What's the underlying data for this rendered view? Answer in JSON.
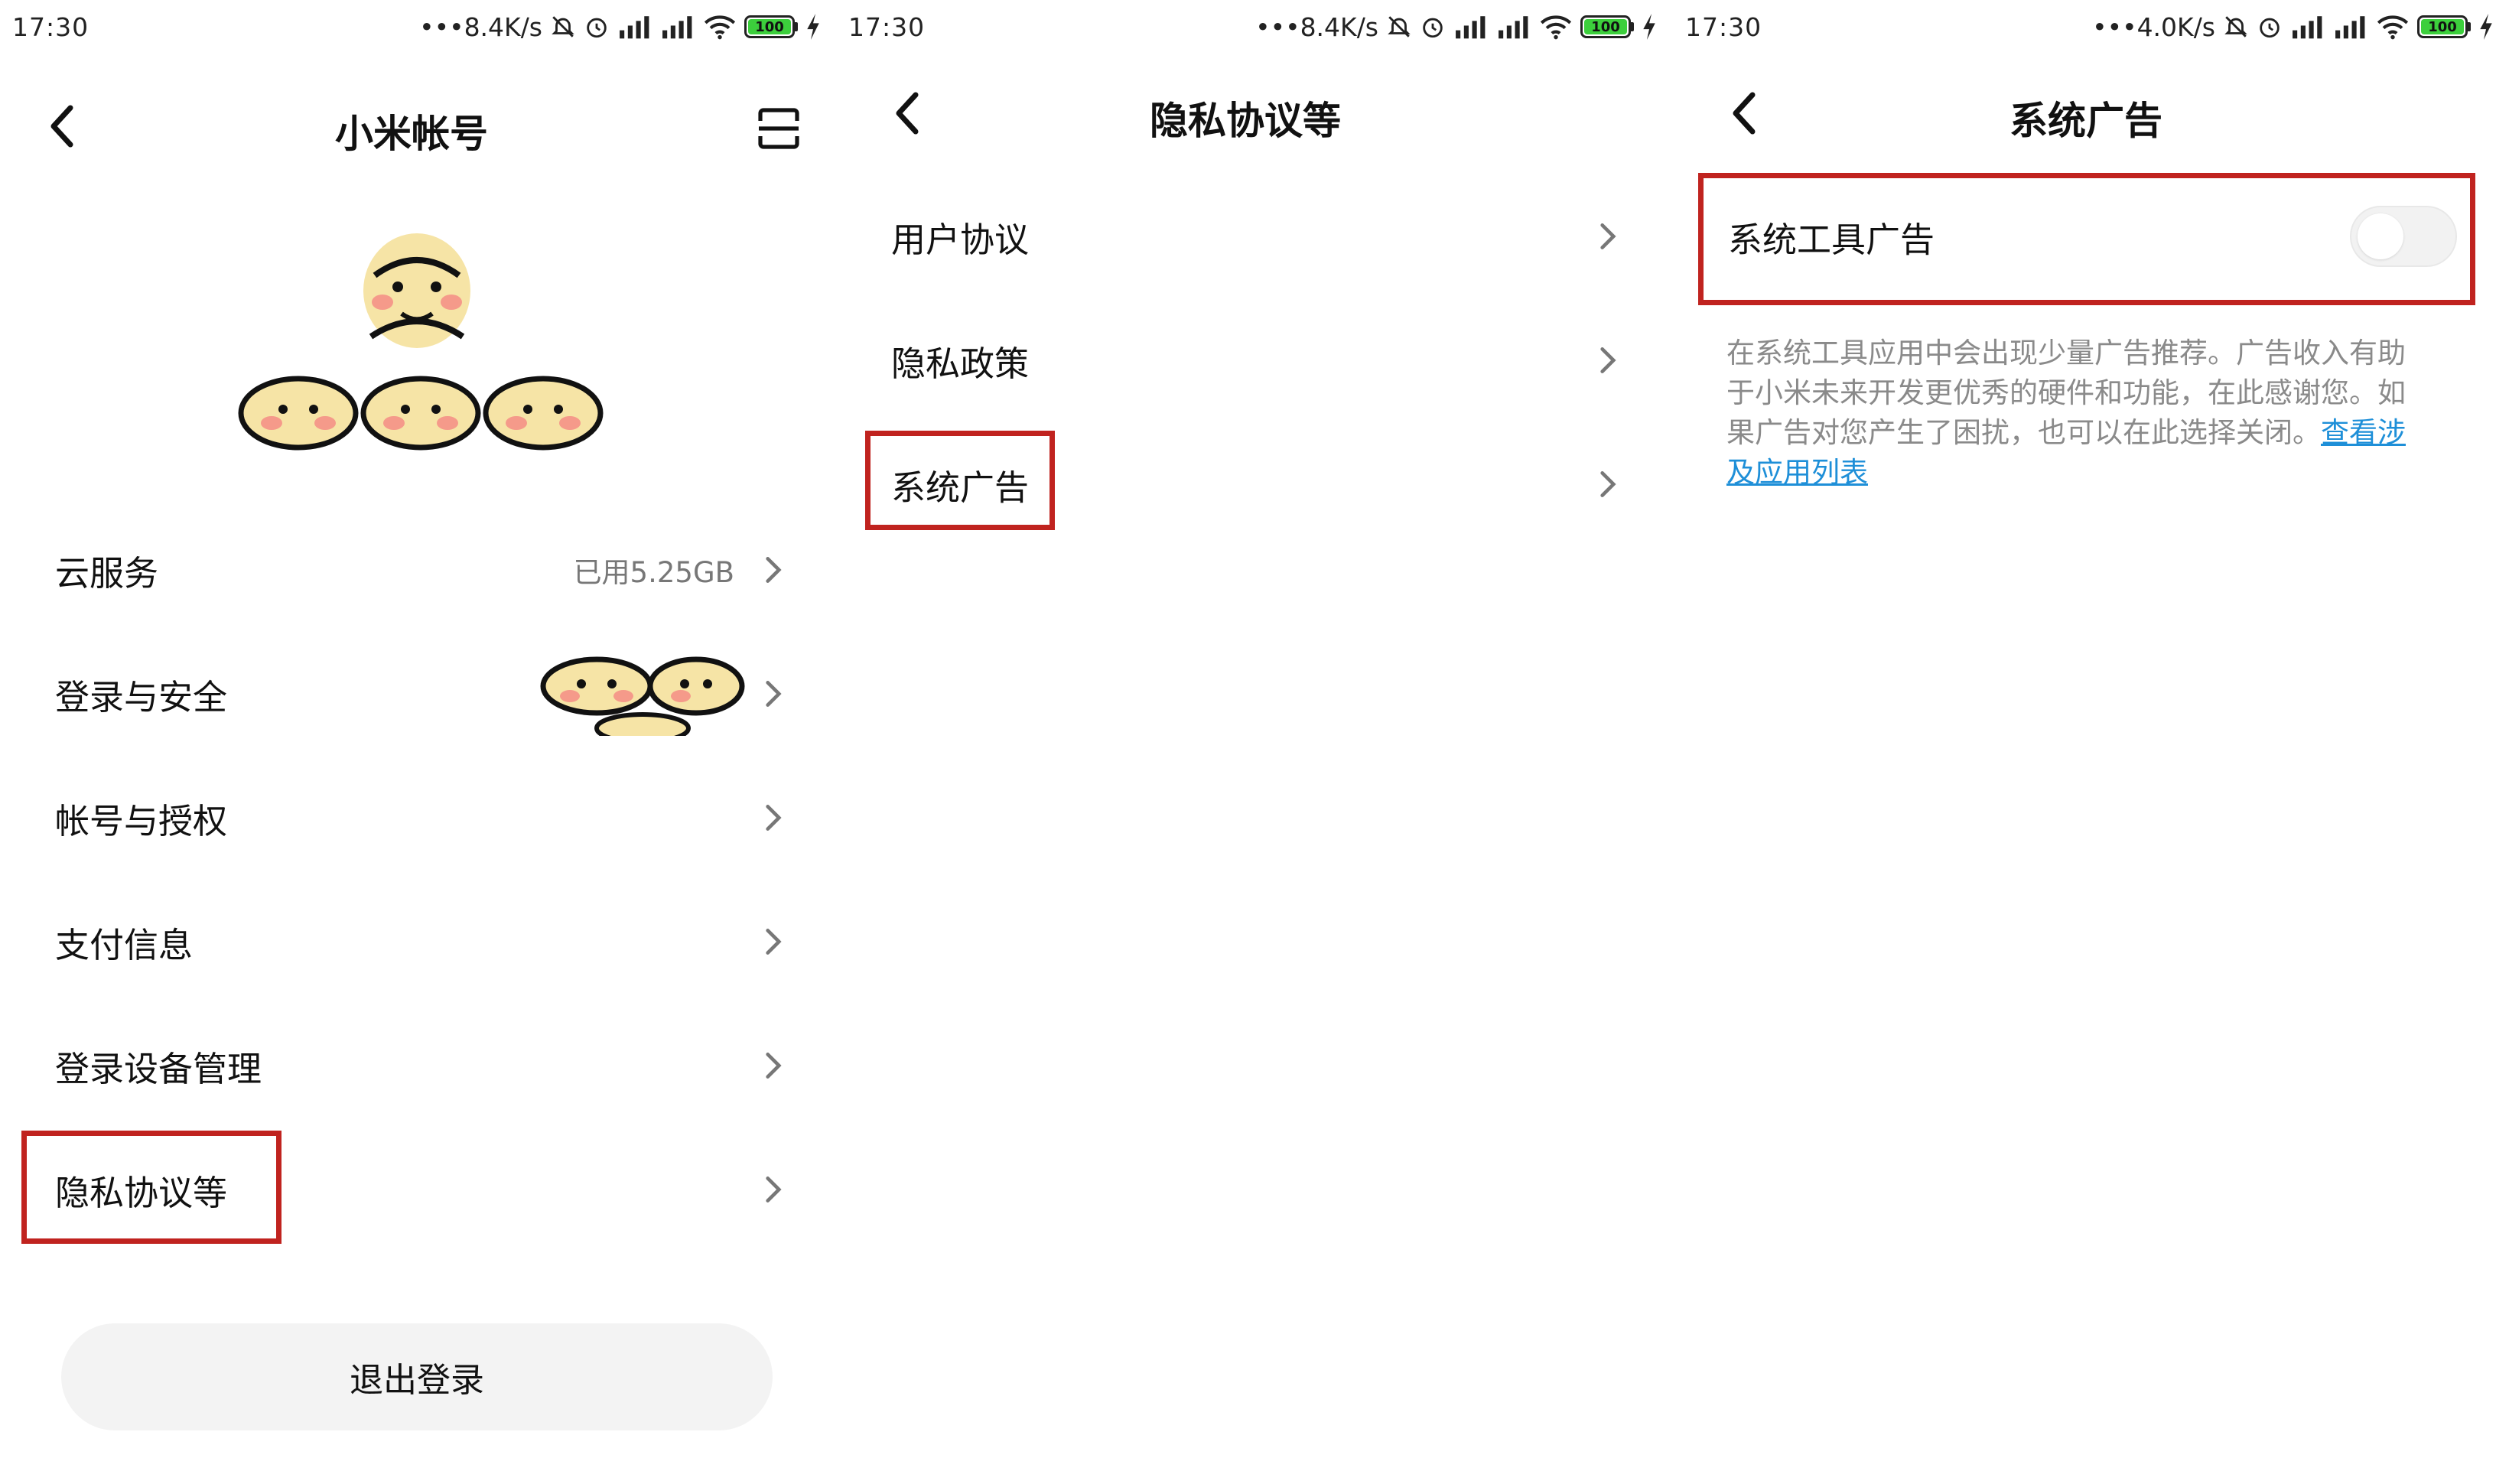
{
  "screen1": {
    "status": {
      "time": "17:30",
      "net_speed": "•••8.4K/s"
    },
    "title": "小米帐号",
    "menu_items": [
      {
        "label": "云服务",
        "value": "已用5.25GB"
      },
      {
        "label": "登录与安全",
        "value": ""
      },
      {
        "label": "帐号与授权",
        "value": ""
      },
      {
        "label": "支付信息",
        "value": ""
      },
      {
        "label": "登录设备管理",
        "value": ""
      },
      {
        "label": "隐私协议等",
        "value": ""
      }
    ],
    "logout_label": "退出登录"
  },
  "screen2": {
    "status": {
      "time": "17:30",
      "net_speed": "•••8.4K/s"
    },
    "title": "隐私协议等",
    "menu_items": [
      {
        "label": "用户协议"
      },
      {
        "label": "隐私政策"
      },
      {
        "label": "系统广告"
      }
    ]
  },
  "screen3": {
    "status": {
      "time": "17:30",
      "net_speed": "•••4.0K/s"
    },
    "title": "系统广告",
    "toggle_label": "系统工具广告",
    "toggle_on": false,
    "description": "在系统工具应用中会出现少量广告推荐。广告收入有助于小米未来开发更优秀的硬件和功能，在此感谢您。如果广告对您产生了困扰，也可以在此选择关闭。",
    "link_text": "查看涉及应用列表"
  },
  "battery_level": "100",
  "colors": {
    "highlight": "#c0231f",
    "link": "#1e8fd8",
    "battery": "#3ccf3c"
  }
}
